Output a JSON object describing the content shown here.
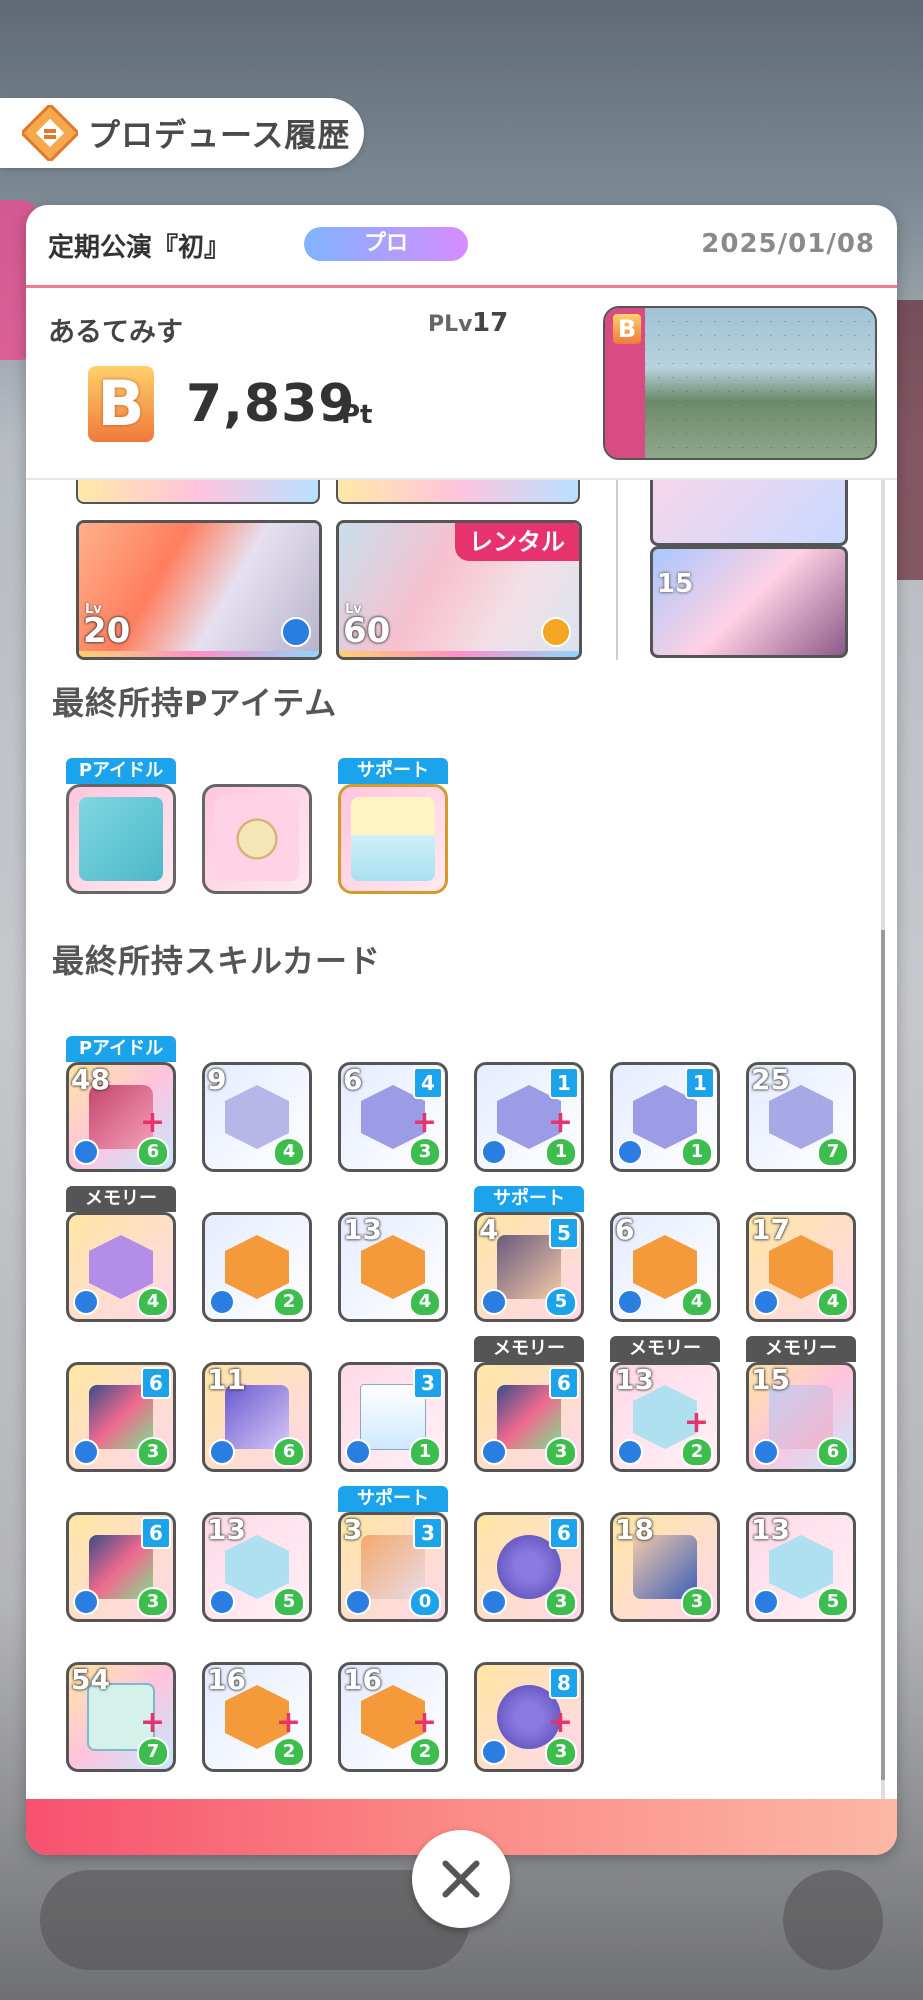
{
  "header": {
    "title": "プロデュース履歴",
    "icon": "history-icon"
  },
  "summary_top": {
    "event_name": "定期公演『初』",
    "mode": "プロ",
    "date": "2025/01/08"
  },
  "producer": {
    "name": "あるてみす",
    "plv_label": "PLv",
    "plv_value": "17",
    "rank": "B",
    "score": "7,839",
    "score_unit": "Pt",
    "stage_rank": "B"
  },
  "support_cards": [
    {
      "lv_label": "Lv",
      "lv": "20"
    },
    {
      "lv_label": "Lv",
      "lv": "60",
      "tag": "レンタル"
    }
  ],
  "mini_cards": [
    {
      "lv": "15"
    }
  ],
  "sections": {
    "p_items": "最終所持Pアイテム",
    "skill_cards": "最終所持スキルカード"
  },
  "p_item_tags": {
    "idol": "Pアイドル",
    "support": "サポート"
  },
  "skill_tags": {
    "idol": "Pアイドル",
    "memory": "メモリー",
    "support": "サポート"
  },
  "skill_cards": {
    "row1": [
      {
        "cost": "48",
        "heart": "6"
      },
      {
        "cost": "9",
        "heart": "4"
      },
      {
        "cost": "6",
        "heart": "3",
        "badge": "4"
      },
      {
        "cost": "",
        "heart": "1",
        "badge": "1"
      },
      {
        "cost": "",
        "heart": "1",
        "badge": "1"
      },
      {
        "cost": "25",
        "heart": "7"
      }
    ],
    "row2": [
      {
        "cost": "",
        "heart": "4"
      },
      {
        "cost": "",
        "heart": "2"
      },
      {
        "cost": "13",
        "heart": "4"
      },
      {
        "cost": "4",
        "heart": "5",
        "badge": "5"
      },
      {
        "cost": "6",
        "heart": "4"
      },
      {
        "cost": "17",
        "heart": "4"
      }
    ],
    "row3": [
      {
        "cost": "",
        "heart": "3",
        "badge": "6"
      },
      {
        "cost": "11",
        "heart": "6"
      },
      {
        "cost": "",
        "heart": "1",
        "badge": "3"
      },
      {
        "cost": "",
        "heart": "3",
        "badge": "6"
      },
      {
        "cost": "13",
        "heart": "2"
      },
      {
        "cost": "15",
        "heart": "6"
      }
    ],
    "row4": [
      {
        "cost": "",
        "heart": "3",
        "badge": "6"
      },
      {
        "cost": "13",
        "heart": "5"
      },
      {
        "cost": "3",
        "heart": "0",
        "badge": "3"
      },
      {
        "cost": "",
        "heart": "3",
        "badge": "6"
      },
      {
        "cost": "18",
        "heart": "3"
      },
      {
        "cost": "13",
        "heart": "5"
      }
    ],
    "row5": [
      {
        "cost": "54",
        "heart": "7"
      },
      {
        "cost": "16",
        "heart": "2"
      },
      {
        "cost": "16",
        "heart": "2"
      },
      {
        "cost": "",
        "heart": "3",
        "badge": "8"
      }
    ]
  },
  "colors": {
    "accent_pink": "#f7516f",
    "badge_blue": "#1ba3ec",
    "heart_green": "#3ebd4f"
  }
}
